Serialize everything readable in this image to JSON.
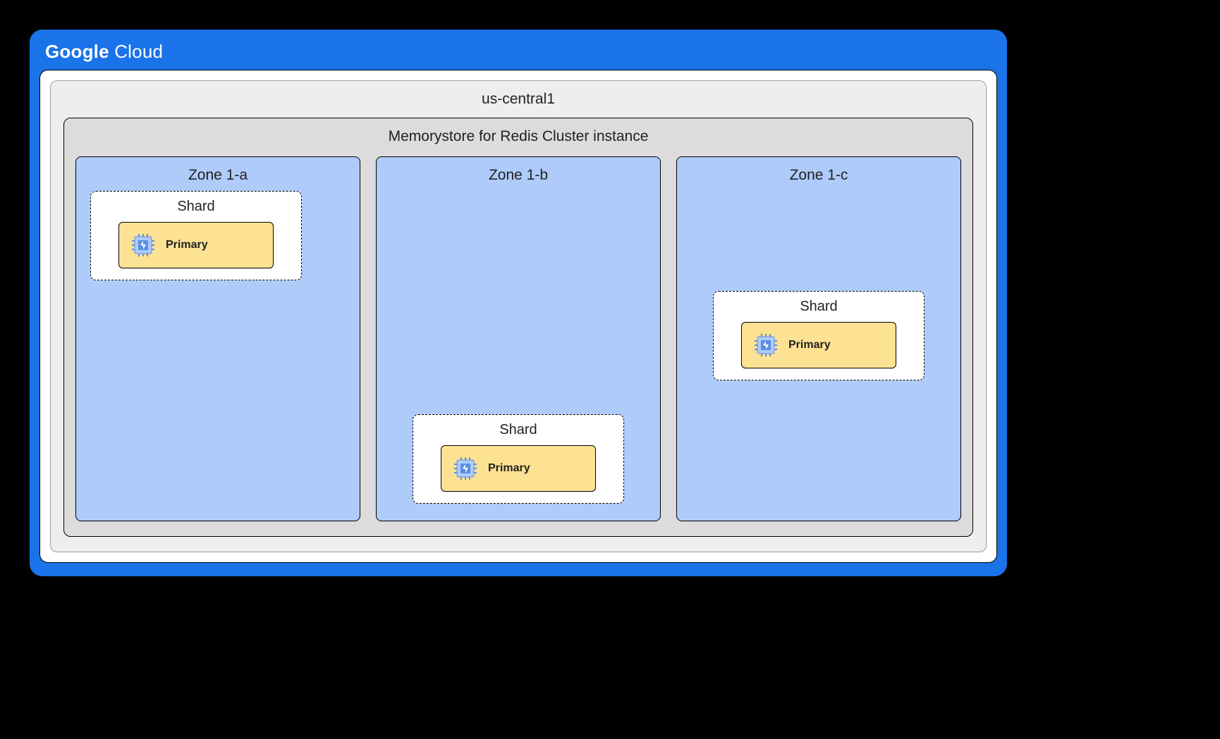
{
  "brand": {
    "word1": "Google",
    "word2": "Cloud"
  },
  "region": {
    "name": "us-central1"
  },
  "instance": {
    "name": "Memorystore for Redis Cluster instance"
  },
  "shard_label": "Shard",
  "node_label": "Primary",
  "zones": [
    {
      "name": "Zone 1-a"
    },
    {
      "name": "Zone 1-b"
    },
    {
      "name": "Zone 1-c"
    }
  ]
}
